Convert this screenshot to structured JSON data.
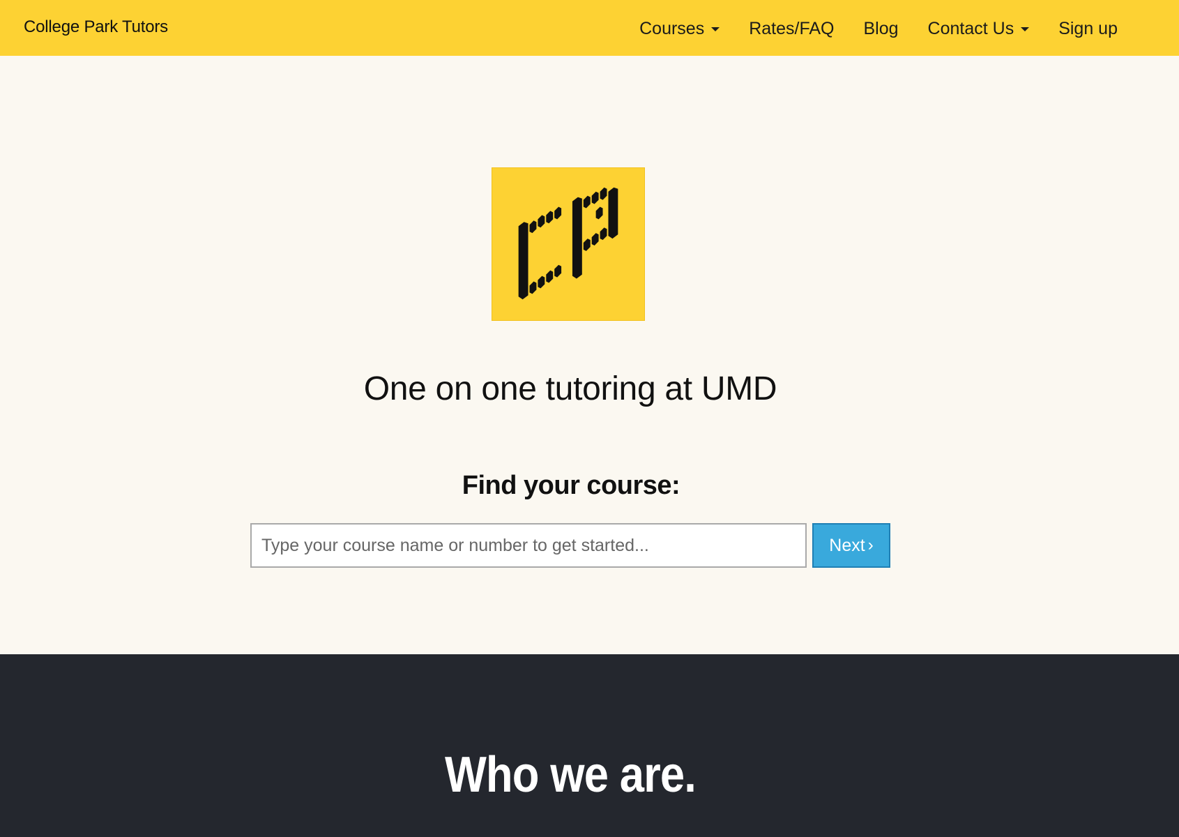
{
  "navbar": {
    "brand": "College Park Tutors",
    "items": [
      {
        "label": "Courses",
        "has_dropdown": true
      },
      {
        "label": "Rates/FAQ",
        "has_dropdown": false
      },
      {
        "label": "Blog",
        "has_dropdown": false
      },
      {
        "label": "Contact Us",
        "has_dropdown": true
      },
      {
        "label": "Sign up",
        "has_dropdown": false
      }
    ]
  },
  "hero": {
    "logo_icon": "college-park-logo-icon",
    "tagline": "One on one tutoring at UMD",
    "find_label": "Find your course:",
    "search": {
      "placeholder": "Type your course name or number to get started...",
      "value": ""
    },
    "next_label": "Next",
    "next_icon": "chevron-right-icon"
  },
  "about": {
    "heading": "Who we are."
  },
  "colors": {
    "brand_yellow": "#fdd233",
    "accent_blue": "#39a9dc",
    "dark_background": "#24272e",
    "page_background": "#fbf8f1"
  }
}
